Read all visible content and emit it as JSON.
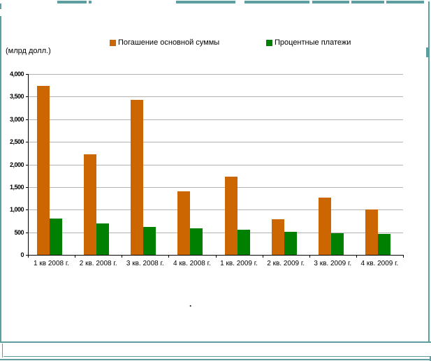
{
  "page": {
    "accent_teal": "#5f9ea0",
    "footnote_dot": "."
  },
  "chart_data": {
    "type": "bar",
    "title": "",
    "xlabel": "",
    "ylabel": "(млрд долл.)",
    "ylim": [
      0,
      4000
    ],
    "grid": true,
    "legend_position": "top",
    "categories": [
      "1 кв 2008 г.",
      "2 кв. 2008 г.",
      "3 кв. 2008 г.",
      "4 кв. 2008 г.",
      "1 кв. 2009 г.",
      "2 кв. 2009 г.",
      "3 кв. 2009 г.",
      "4 кв. 2009 г."
    ],
    "yticks": [
      {
        "value": 0,
        "label": "0"
      },
      {
        "value": 500,
        "label": "500"
      },
      {
        "value": 1000,
        "label": "1,000"
      },
      {
        "value": 1500,
        "label": "1,500"
      },
      {
        "value": 2000,
        "label": "2,000"
      },
      {
        "value": 2500,
        "label": "2,500"
      },
      {
        "value": 3000,
        "label": "3,000"
      },
      {
        "value": 3500,
        "label": "3,500"
      },
      {
        "value": 4000,
        "label": "4,000"
      }
    ],
    "series": [
      {
        "name": "Погашение основной суммы",
        "color": "#cc6600",
        "values": [
          3740,
          2230,
          3430,
          1410,
          1730,
          780,
          1260,
          1000
        ]
      },
      {
        "name": "Процентные платежи",
        "color": "#008000",
        "values": [
          810,
          700,
          620,
          590,
          550,
          505,
          480,
          460
        ]
      }
    ],
    "colors": {
      "gridline": "#b3b3b3",
      "axis": "#000000"
    }
  }
}
